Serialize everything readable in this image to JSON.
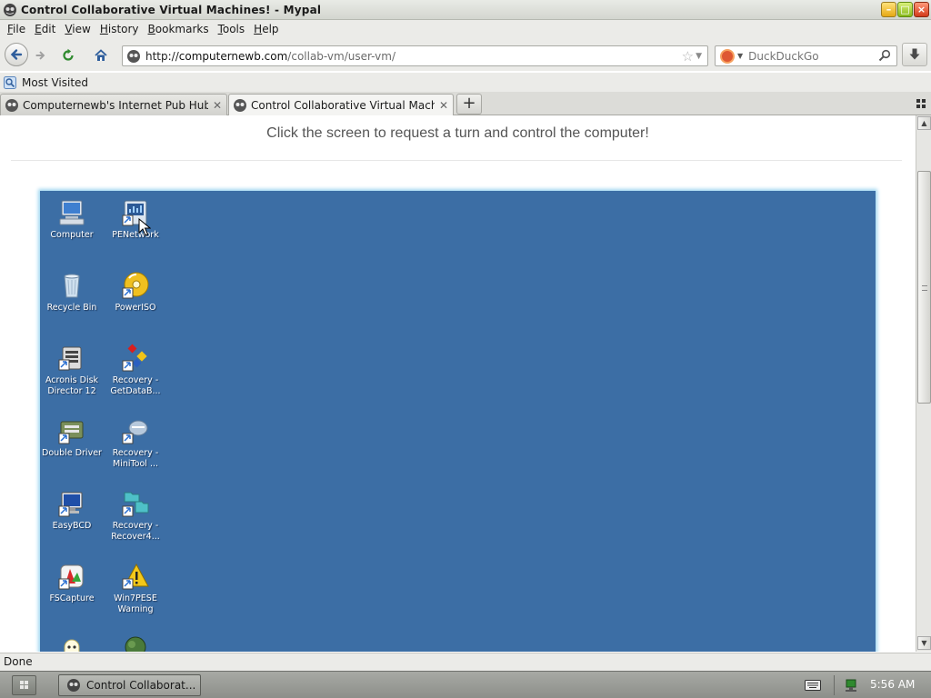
{
  "window": {
    "title": "Control Collaborative Virtual Machines! - Mypal"
  },
  "menu": [
    {
      "label": "File",
      "key": "F",
      "rest": "ile"
    },
    {
      "label": "Edit",
      "key": "E",
      "rest": "dit"
    },
    {
      "label": "View",
      "key": "V",
      "rest": "iew"
    },
    {
      "label": "History",
      "key": "H",
      "rest": "istory"
    },
    {
      "label": "Bookmarks",
      "key": "B",
      "rest": "ookmarks"
    },
    {
      "label": "Tools",
      "key": "T",
      "rest": "ools"
    },
    {
      "label": "Help",
      "key": "H",
      "rest": "elp"
    }
  ],
  "urlbar": {
    "scheme": "http://",
    "host": "computernewb.com",
    "path": "/collab-vm/user-vm/"
  },
  "search": {
    "engine": "DuckDuckGo",
    "placeholder": "DuckDuckGo"
  },
  "bookmarks": {
    "most_visited": "Most Visited"
  },
  "tabs": [
    {
      "label": "Computernewb's Internet Pub Hub",
      "active": false
    },
    {
      "label": "Control Collaborative Virtual Mach...",
      "active": true
    }
  ],
  "page": {
    "instruction": "Click the screen to request a turn and control the computer!"
  },
  "desktop_icons": [
    {
      "label": "Computer",
      "icon": "computer-icon"
    },
    {
      "label": "PENetwork",
      "icon": "network-icon"
    },
    {
      "label": "Recycle Bin",
      "icon": "recycle-bin-icon"
    },
    {
      "label": "PowerISO",
      "icon": "disc-icon"
    },
    {
      "label": "Acronis Disk Director 12",
      "icon": "disk-tool-icon"
    },
    {
      "label": "Recovery - GetDataB...",
      "icon": "recovery-icon"
    },
    {
      "label": "Double Driver",
      "icon": "driver-icon"
    },
    {
      "label": "Recovery - MiniTool ...",
      "icon": "minitool-icon"
    },
    {
      "label": "EasyBCD",
      "icon": "monitor-icon"
    },
    {
      "label": "Recovery - Recover4...",
      "icon": "folder-icon"
    },
    {
      "label": "FSCapture",
      "icon": "capture-icon"
    },
    {
      "label": "Win7PESE Warning",
      "icon": "warning-icon"
    }
  ],
  "status": {
    "text": "Done"
  },
  "taskbar": {
    "task_label": "Control Collaborat...",
    "clock": "5:56 AM"
  },
  "colors": {
    "vm_desktop": "#3c6ea5",
    "vm_glow": "#9fd6f0",
    "chrome_bg": "#ebebe8"
  }
}
